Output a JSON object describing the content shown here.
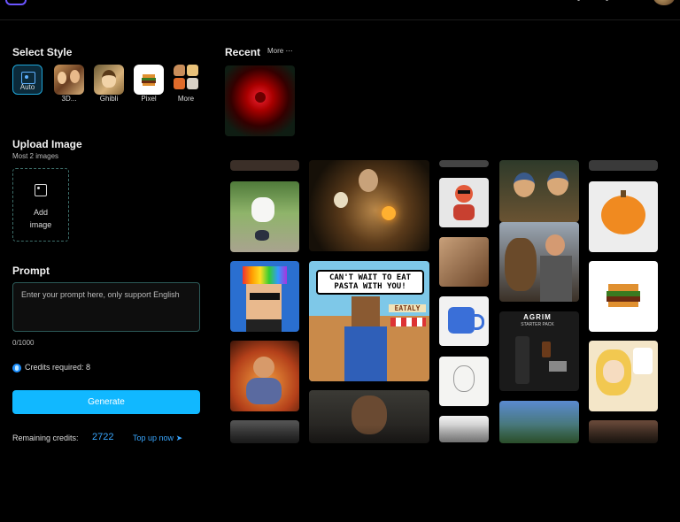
{
  "left_panel": {
    "select_style": {
      "title": "Select Style",
      "items": [
        {
          "label": "Auto",
          "active": true
        },
        {
          "label": "3D..."
        },
        {
          "label": "Ghibli"
        },
        {
          "label": "Pixel"
        },
        {
          "label": "More"
        }
      ]
    },
    "upload": {
      "title": "Upload Image",
      "hint": "Most 2 images",
      "button_line1": "Add",
      "button_line2": "image"
    },
    "prompt": {
      "title": "Prompt",
      "placeholder": "Enter your prompt here, only support English",
      "counter": "0/1000"
    },
    "credits_required": "Credits required: 8",
    "generate_label": "Generate",
    "remaining_label": "Remaining credits:",
    "remaining_value": "2722",
    "topup_label": "Top up now"
  },
  "recent": {
    "title": "Recent",
    "more_label": "More"
  },
  "gallery": {
    "pasta_speech": "CAN'T WAIT TO EAT PASTA WITH YOU!",
    "eataly_sign": "EATALY",
    "agrim_title": "AGRIM",
    "agrim_sub": "STARTER PACK"
  },
  "icons": {
    "auto": "image-ai-icon",
    "upload": "image-icon",
    "credits": "credit-coin-icon",
    "topup": "rocket-icon",
    "more": "ellipsis-icon"
  },
  "colors": {
    "accent": "#11b8ff",
    "link": "#39a7ff",
    "border": "#2c5a58"
  }
}
